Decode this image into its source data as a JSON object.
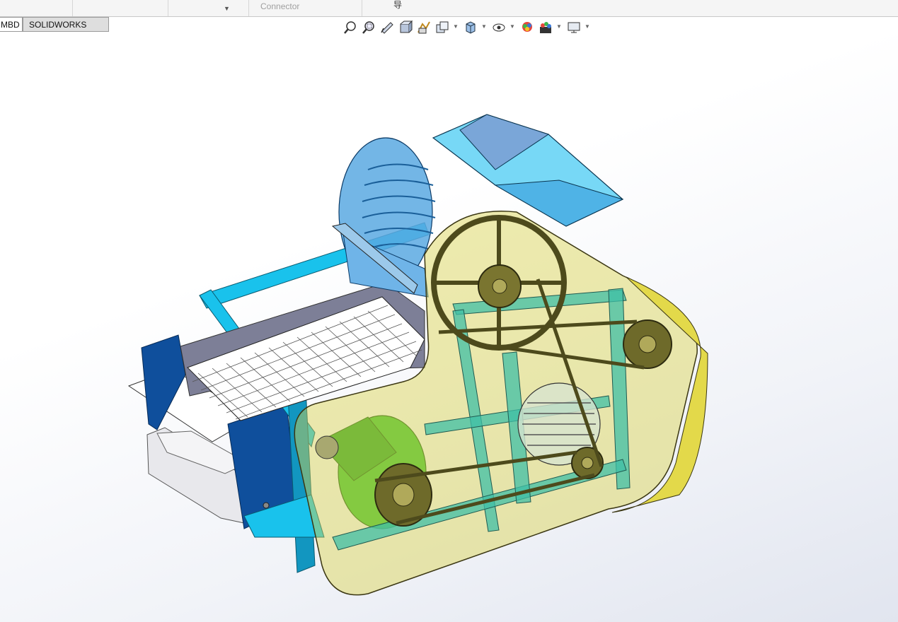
{
  "top_bar": {
    "connector_label": "Connector",
    "glyph": "导"
  },
  "tabs": [
    {
      "label": "MBD",
      "active": false
    },
    {
      "label": "SOLIDWORKS CAM",
      "active": true
    }
  ],
  "heads_up_toolbar": {
    "icons": [
      "zoom-to-fit-icon",
      "zoom-to-area-icon",
      "previous-view-icon",
      "section-view-icon",
      "dynamic-annotation-icon",
      "view-orientation-icon",
      "display-style-icon",
      "hide-show-items-icon",
      "edit-appearance-icon",
      "apply-scene-icon",
      "view-settings-icon"
    ]
  },
  "colors": {
    "frame_cyan": "#19c2ec",
    "guard_yellow": "#d9d24c",
    "hopper_blue": "#5aa9e2",
    "panel_navy": "#0f4f9c",
    "motor_green": "#3ec43a",
    "belt_dark": "#4d4a1c"
  }
}
